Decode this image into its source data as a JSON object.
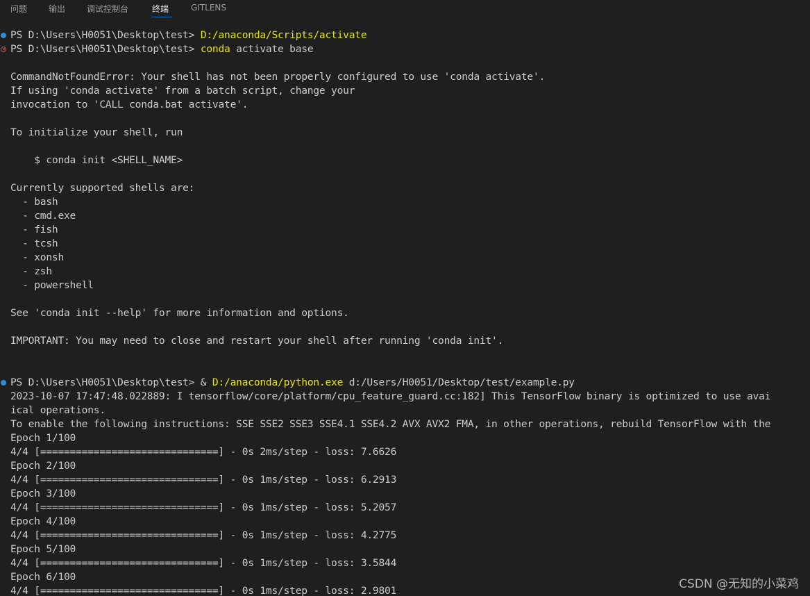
{
  "panel": {
    "tabs": [
      {
        "label": "问题",
        "active": false
      },
      {
        "label": "输出",
        "active": false
      },
      {
        "label": "调试控制台",
        "active": false
      },
      {
        "label": "终端",
        "active": true
      },
      {
        "label": "GITLENS",
        "active": false
      }
    ]
  },
  "terminal": {
    "lines": [
      {
        "segments": [
          "PS D:\\Users\\H0051\\Desktop\\test> ",
          "D:/anaconda/Scripts/activate"
        ],
        "decoration": "success"
      },
      {
        "segments": [
          "PS D:\\Users\\H0051\\Desktop\\test> ",
          "conda",
          " activate base"
        ],
        "decoration": "error"
      },
      {
        "segments": [
          ""
        ]
      },
      {
        "segments": [
          "CommandNotFoundError: Your shell has not been properly configured to use 'conda activate'."
        ]
      },
      {
        "segments": [
          "If using 'conda activate' from a batch script, change your"
        ]
      },
      {
        "segments": [
          "invocation to 'CALL conda.bat activate'."
        ]
      },
      {
        "segments": [
          ""
        ]
      },
      {
        "segments": [
          "To initialize your shell, run"
        ]
      },
      {
        "segments": [
          ""
        ]
      },
      {
        "segments": [
          "    $ conda init <SHELL_NAME>"
        ]
      },
      {
        "segments": [
          ""
        ]
      },
      {
        "segments": [
          "Currently supported shells are:"
        ]
      },
      {
        "segments": [
          "  - bash"
        ]
      },
      {
        "segments": [
          "  - cmd.exe"
        ]
      },
      {
        "segments": [
          "  - fish"
        ]
      },
      {
        "segments": [
          "  - tcsh"
        ]
      },
      {
        "segments": [
          "  - xonsh"
        ]
      },
      {
        "segments": [
          "  - zsh"
        ]
      },
      {
        "segments": [
          "  - powershell"
        ]
      },
      {
        "segments": [
          ""
        ]
      },
      {
        "segments": [
          "See 'conda init --help' for more information and options."
        ]
      },
      {
        "segments": [
          ""
        ]
      },
      {
        "segments": [
          "IMPORTANT: You may need to close and restart your shell after running 'conda init'."
        ]
      },
      {
        "segments": [
          ""
        ]
      },
      {
        "segments": [
          ""
        ]
      },
      {
        "segments": [
          "PS D:\\Users\\H0051\\Desktop\\test> & ",
          "D:/anaconda/python.exe",
          " d:/Users/H0051/Desktop/test/example.py"
        ],
        "decoration": "success"
      },
      {
        "segments": [
          "2023-10-07 17:47:48.022889: I tensorflow/core/platform/cpu_feature_guard.cc:182] This TensorFlow binary is optimized to use avai"
        ]
      },
      {
        "segments": [
          "ical operations."
        ]
      },
      {
        "segments": [
          "To enable the following instructions: SSE SSE2 SSE3 SSE4.1 SSE4.2 AVX AVX2 FMA, in other operations, rebuild TensorFlow with the"
        ]
      },
      {
        "segments": [
          "Epoch 1/100"
        ]
      },
      {
        "segments": [
          "4/4 [==============================] - 0s 2ms/step - loss: 7.6626"
        ]
      },
      {
        "segments": [
          "Epoch 2/100"
        ]
      },
      {
        "segments": [
          "4/4 [==============================] - 0s 1ms/step - loss: 6.2913"
        ]
      },
      {
        "segments": [
          "Epoch 3/100"
        ]
      },
      {
        "segments": [
          "4/4 [==============================] - 0s 1ms/step - loss: 5.2057"
        ]
      },
      {
        "segments": [
          "Epoch 4/100"
        ]
      },
      {
        "segments": [
          "4/4 [==============================] - 0s 1ms/step - loss: 4.2775"
        ]
      },
      {
        "segments": [
          "Epoch 5/100"
        ]
      },
      {
        "segments": [
          "4/4 [==============================] - 0s 1ms/step - loss: 3.5844"
        ]
      },
      {
        "segments": [
          "Epoch 6/100"
        ]
      },
      {
        "segments": [
          "4/4 [==============================] - 0s 1ms/step - loss: 2.9801"
        ]
      }
    ]
  },
  "watermark": "CSDN @无知的小菜鸡",
  "colors": {
    "background": "#1f1f1f",
    "text": "#cccccc",
    "highlight": "#e5e510",
    "decoration_success": "#2e8bd6",
    "decoration_error": "#e05252",
    "active_tab_underline": "#0078d4"
  }
}
